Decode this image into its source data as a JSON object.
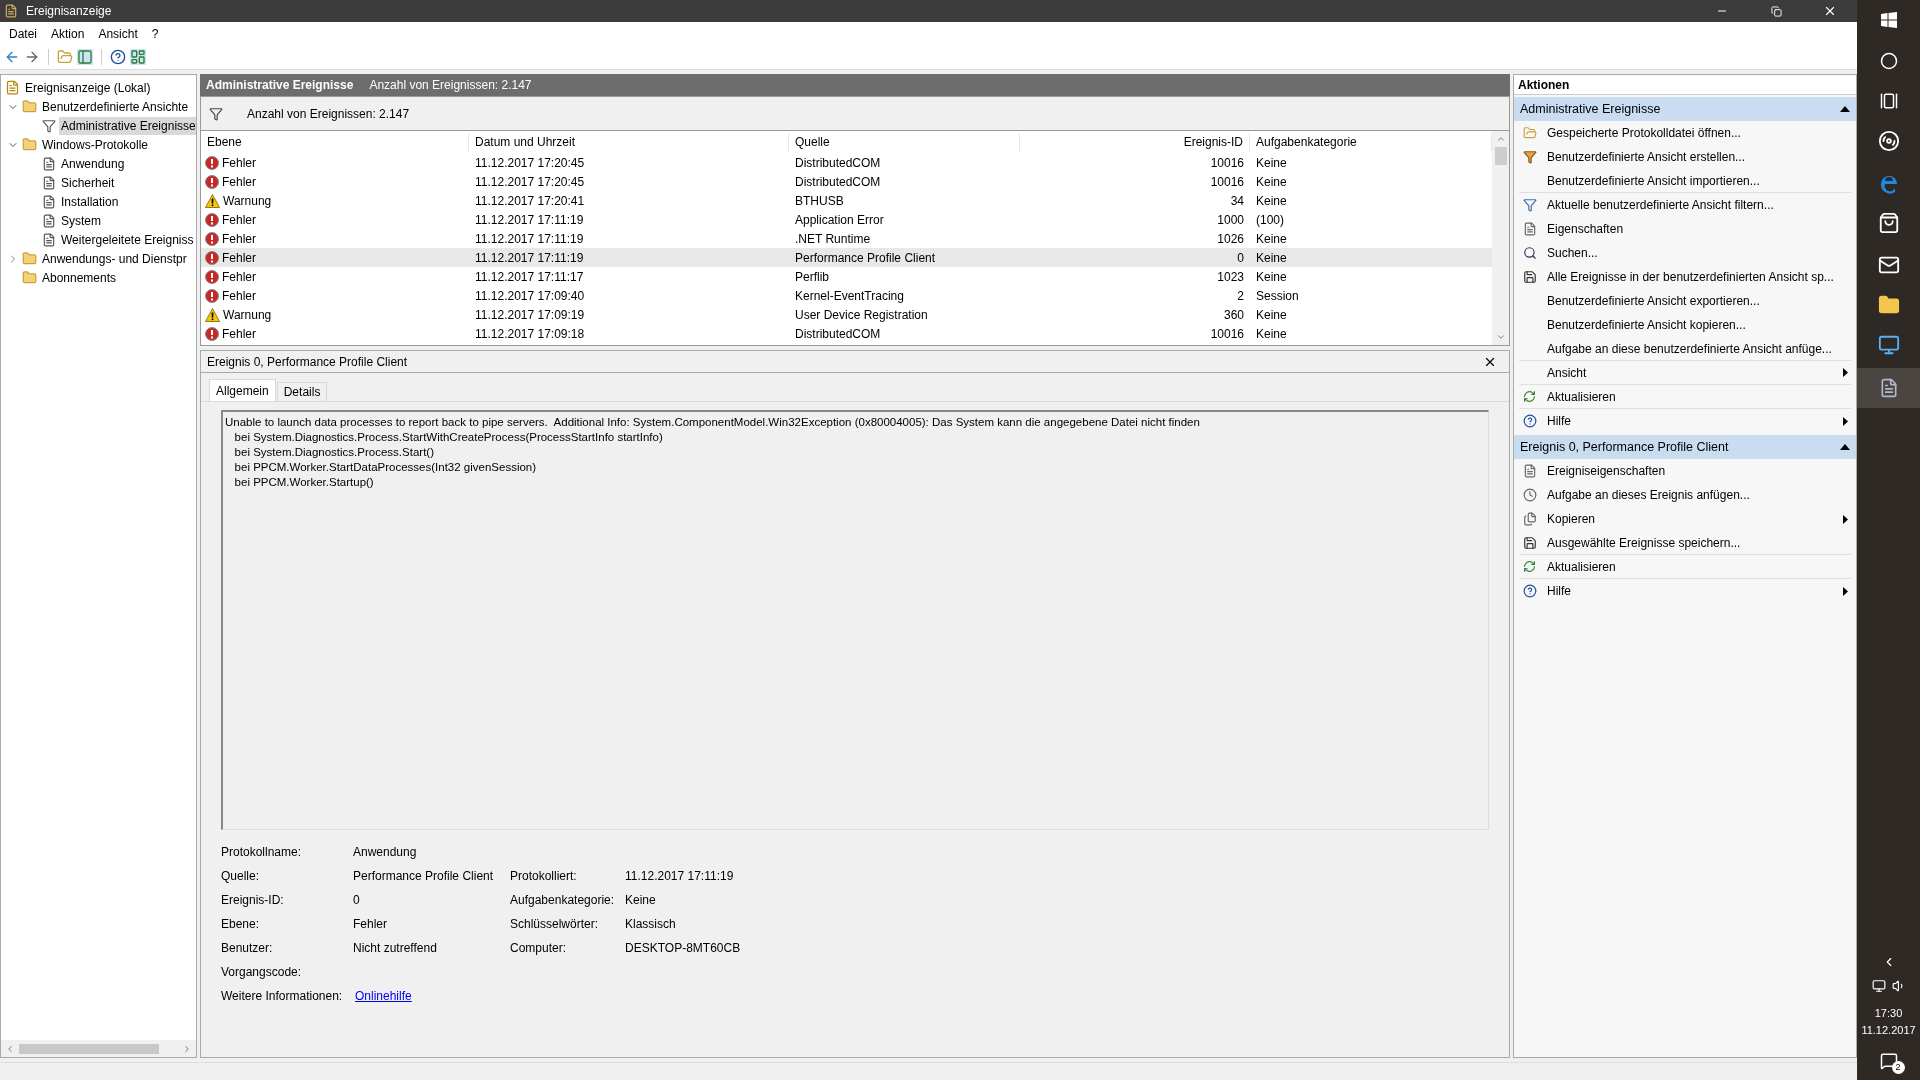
{
  "window": {
    "title": "Ereignisanzeige"
  },
  "menu": [
    "Datei",
    "Aktion",
    "Ansicht",
    "?"
  ],
  "tree": [
    {
      "label": "Ereignisanzeige (Lokal)",
      "kind": "computer",
      "selected": false,
      "children": [
        {
          "label": "Benutzerdefinierte Ansichte",
          "kind": "folder",
          "expanded": true,
          "selected": false,
          "children": [
            {
              "label": "Administrative Ereignisse",
              "kind": "filter",
              "selected": true
            }
          ]
        },
        {
          "label": "Windows-Protokolle",
          "kind": "folder",
          "expanded": true,
          "selected": false,
          "children": [
            {
              "label": "Anwendung",
              "kind": "log",
              "selected": false
            },
            {
              "label": "Sicherheit",
              "kind": "log",
              "selected": false
            },
            {
              "label": "Installation",
              "kind": "log",
              "selected": false
            },
            {
              "label": "System",
              "kind": "log",
              "selected": false
            },
            {
              "label": "Weitergeleitete Ereigniss",
              "kind": "log",
              "selected": false
            }
          ]
        },
        {
          "label": "Anwendungs- und Dienstpr",
          "kind": "folder",
          "expanded": false,
          "selected": false
        },
        {
          "label": "Abonnements",
          "kind": "folder",
          "selected": false
        }
      ]
    }
  ],
  "view_header": {
    "title": "Administrative Ereignisse",
    "count": "Anzahl von Ereignissen: 2.147"
  },
  "filter_bar": {
    "text": "Anzahl von Ereignissen: 2.147"
  },
  "table": {
    "columns": [
      "Ebene",
      "Datum und Uhrzeit",
      "Quelle",
      "Ereignis-ID",
      "Aufgabenkategorie"
    ],
    "rows": [
      {
        "kind": "error",
        "level": "Fehler",
        "date": "11.12.2017 17:20:45",
        "source": "DistributedCOM",
        "id": "10016",
        "category": "Keine",
        "selected": false
      },
      {
        "kind": "error",
        "level": "Fehler",
        "date": "11.12.2017 17:20:45",
        "source": "DistributedCOM",
        "id": "10016",
        "category": "Keine",
        "selected": false
      },
      {
        "kind": "warning",
        "level": "Warnung",
        "date": "11.12.2017 17:20:41",
        "source": "BTHUSB",
        "id": "34",
        "category": "Keine",
        "selected": false
      },
      {
        "kind": "error",
        "level": "Fehler",
        "date": "11.12.2017 17:11:19",
        "source": "Application Error",
        "id": "1000",
        "category": "(100)",
        "selected": false
      },
      {
        "kind": "error",
        "level": "Fehler",
        "date": "11.12.2017 17:11:19",
        "source": ".NET Runtime",
        "id": "1026",
        "category": "Keine",
        "selected": false
      },
      {
        "kind": "error",
        "level": "Fehler",
        "date": "11.12.2017 17:11:19",
        "source": "Performance Profile Client",
        "id": "0",
        "category": "Keine",
        "selected": true
      },
      {
        "kind": "error",
        "level": "Fehler",
        "date": "11.12.2017 17:11:17",
        "source": "Perflib",
        "id": "1023",
        "category": "Keine",
        "selected": false
      },
      {
        "kind": "error",
        "level": "Fehler",
        "date": "11.12.2017 17:09:40",
        "source": "Kernel-EventTracing",
        "id": "2",
        "category": "Session",
        "selected": false
      },
      {
        "kind": "warning",
        "level": "Warnung",
        "date": "11.12.2017 17:09:19",
        "source": "User Device Registration",
        "id": "360",
        "category": "Keine",
        "selected": false
      },
      {
        "kind": "error",
        "level": "Fehler",
        "date": "11.12.2017 17:09:18",
        "source": "DistributedCOM",
        "id": "10016",
        "category": "Keine",
        "selected": false
      }
    ]
  },
  "detail": {
    "title": "Ereignis 0, Performance Profile Client",
    "tabs": [
      {
        "label": "Allgemein",
        "selected": true
      },
      {
        "label": "Details",
        "selected": false
      }
    ],
    "message": [
      "Unable to launch data processes to report back to pipe servers.  Additional Info: System.ComponentModel.Win32Exception (0x80004005): Das System kann die angegebene Datei nicht finden",
      "   bei System.Diagnostics.Process.StartWithCreateProcess(ProcessStartInfo startInfo)",
      "   bei System.Diagnostics.Process.Start()",
      "   bei PPCM.Worker.StartDataProcesses(Int32 givenSession)",
      "   bei PPCM.Worker.Startup()"
    ],
    "fields": [
      {
        "label": "Protokollname:",
        "value": "Anwendung"
      },
      {
        "label": "Quelle:",
        "value": "Performance Profile Client",
        "label2": "Protokolliert:",
        "value2": "11.12.2017 17:11:19"
      },
      {
        "label": "Ereignis-ID:",
        "value": "0",
        "label2": "Aufgabenkategorie:",
        "value2": "Keine"
      },
      {
        "label": "Ebene:",
        "value": "Fehler",
        "label2": "Schlüsselwörter:",
        "value2": "Klassisch"
      },
      {
        "label": "Benutzer:",
        "value": "Nicht zutreffend",
        "label2": "Computer:",
        "value2": "DESKTOP-8MT60CB"
      },
      {
        "label": "Vorgangscode:"
      },
      {
        "label": "Weitere Informationen:",
        "link": "Onlinehilfe"
      }
    ]
  },
  "actions": {
    "title": "Aktionen",
    "sections": [
      {
        "title": "Administrative Ereignisse",
        "expanded": true,
        "items": [
          {
            "kind": "open",
            "label": "Gespeicherte Protokolldatei öffnen..."
          },
          {
            "kind": "create",
            "label": "Benutzerdefinierte Ansicht erstellen..."
          },
          {
            "kind": "none",
            "label": "Benutzerdefinierte Ansicht importieren...",
            "divider": true
          },
          {
            "kind": "filter",
            "label": "Aktuelle benutzerdefinierte Ansicht filtern..."
          },
          {
            "kind": "properties",
            "label": "Eigenschaften"
          },
          {
            "kind": "search",
            "label": "Suchen..."
          },
          {
            "kind": "save",
            "label": "Alle Ereignisse in der benutzerdefinierten Ansicht sp..."
          },
          {
            "kind": "none",
            "label": "Benutzerdefinierte Ansicht exportieren..."
          },
          {
            "kind": "none",
            "label": "Benutzerdefinierte Ansicht kopieren..."
          },
          {
            "kind": "none",
            "label": "Aufgabe an diese benutzerdefinierte Ansicht anfüge...",
            "divider": true
          },
          {
            "kind": "none",
            "label": "Ansicht",
            "submenu": true,
            "divider": true
          },
          {
            "kind": "refresh",
            "label": "Aktualisieren",
            "divider": true
          },
          {
            "kind": "help",
            "label": "Hilfe",
            "submenu": true
          }
        ]
      },
      {
        "title": "Ereignis 0, Performance Profile Client",
        "expanded": true,
        "items": [
          {
            "kind": "properties",
            "label": "Ereigniseigenschaften"
          },
          {
            "kind": "task",
            "label": "Aufgabe an dieses Ereignis anfügen..."
          },
          {
            "kind": "copy",
            "label": "Kopieren",
            "submenu": true
          },
          {
            "kind": "save",
            "label": "Ausgewählte Ereignisse speichern...",
            "divider": true
          },
          {
            "kind": "refresh",
            "label": "Aktualisieren",
            "divider": true
          },
          {
            "kind": "help",
            "label": "Hilfe",
            "submenu": true
          }
        ]
      }
    ]
  },
  "taskbar": {
    "time": "17:30",
    "date": "11.12.2017",
    "notifications": "2"
  }
}
